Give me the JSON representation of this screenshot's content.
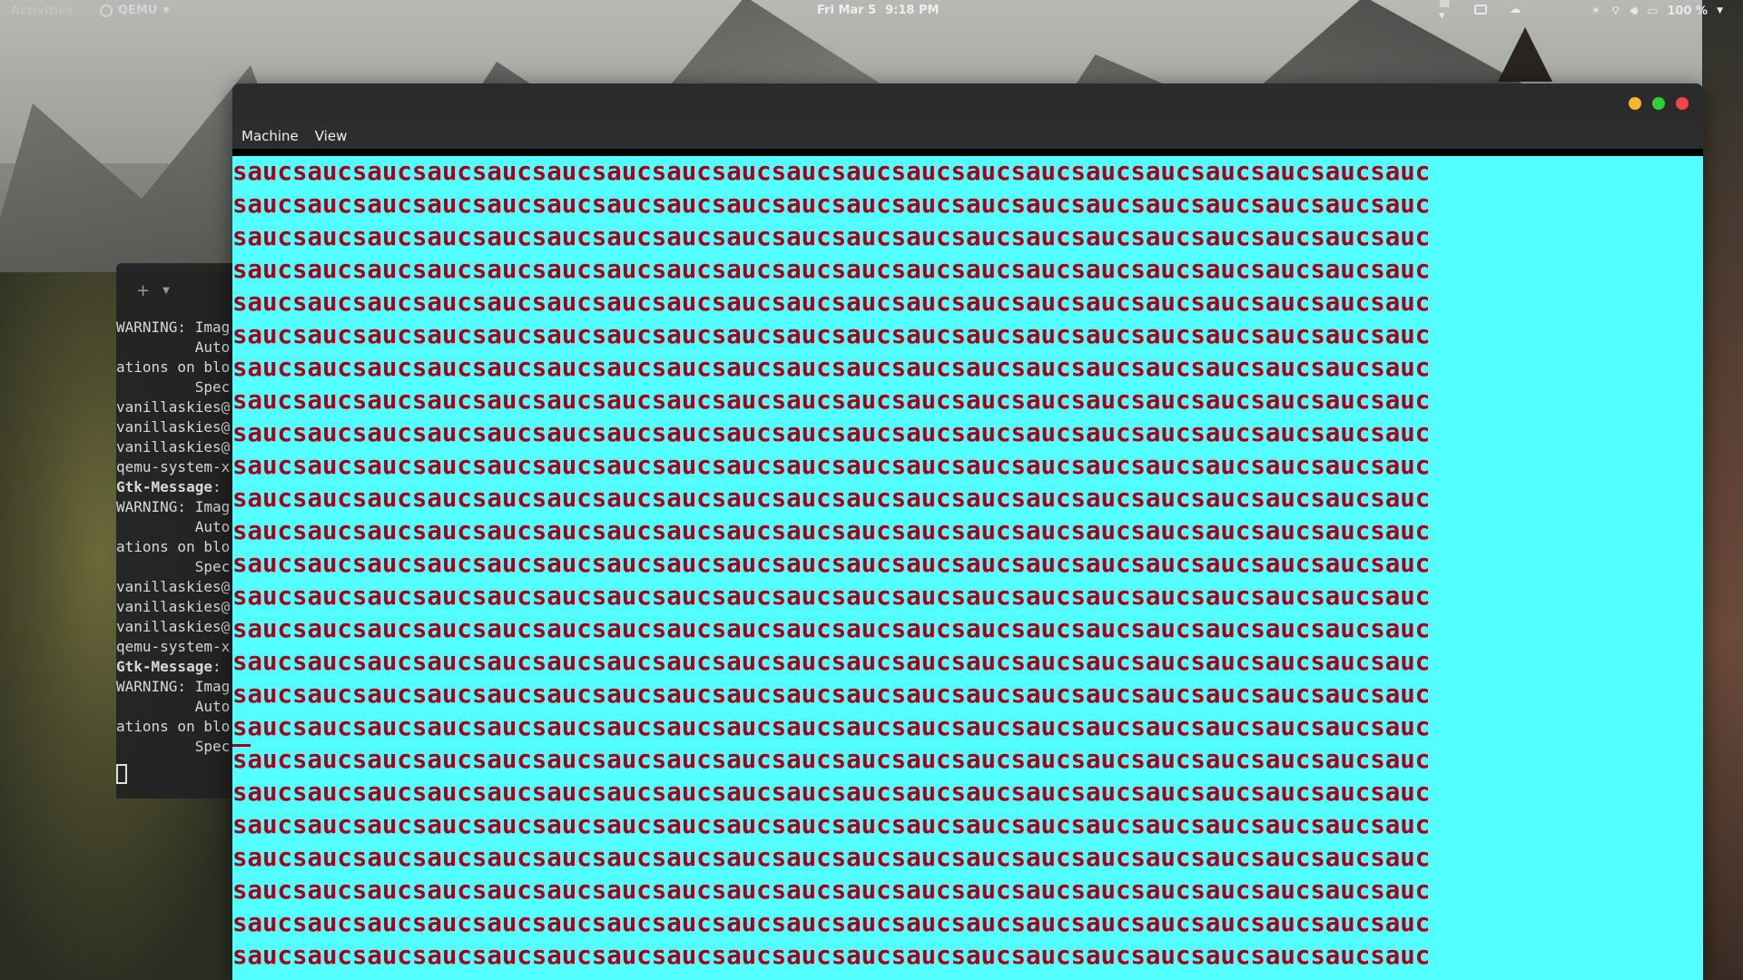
{
  "topbar": {
    "activities": "Activities",
    "app_name": "QEMU",
    "date": "Fri Mar 5",
    "time": "9:18 PM",
    "battery": "100 %"
  },
  "terminal": {
    "lines": [
      {
        "text": "WARNING: Imag",
        "bold_prefix": ""
      },
      {
        "text": "         Auto",
        "bold_prefix": ""
      },
      {
        "text": "ations on blo",
        "bold_prefix": ""
      },
      {
        "text": "         Spec",
        "bold_prefix": ""
      },
      {
        "text": "vanillaskies@",
        "bold_prefix": ""
      },
      {
        "text": "vanillaskies@",
        "bold_prefix": ""
      },
      {
        "text": "vanillaskies@",
        "bold_prefix": ""
      },
      {
        "text": "qemu-system-x",
        "bold_prefix": ""
      },
      {
        "text": ":",
        "bold_prefix": "Gtk-Message"
      },
      {
        "text": "WARNING: Imag",
        "bold_prefix": ""
      },
      {
        "text": "         Auto",
        "bold_prefix": ""
      },
      {
        "text": "ations on blo",
        "bold_prefix": ""
      },
      {
        "text": "         Spec",
        "bold_prefix": ""
      },
      {
        "text": "vanillaskies@",
        "bold_prefix": ""
      },
      {
        "text": "vanillaskies@",
        "bold_prefix": ""
      },
      {
        "text": "vanillaskies@",
        "bold_prefix": ""
      },
      {
        "text": "qemu-system-x",
        "bold_prefix": ""
      },
      {
        "text": ":",
        "bold_prefix": "Gtk-Message"
      },
      {
        "text": "WARNING: Imag",
        "bold_prefix": ""
      },
      {
        "text": "         Auto",
        "bold_prefix": ""
      },
      {
        "text": "ations on blo",
        "bold_prefix": ""
      },
      {
        "text": "         Spec",
        "bold_prefix": ""
      }
    ]
  },
  "qemu": {
    "menu": [
      "Machine",
      "View"
    ],
    "screen_rows": [
      "saucsaucsaucsaucsaucsaucsaucsaucsaucsaucsaucsaucsaucsaucsaucsaucsaucsaucsaucsauc",
      "saucsaucsaucsaucsaucsaucsaucsaucsaucsaucsaucsaucsaucsaucsaucsaucsaucsaucsaucsauc",
      "saucsaucsaucsaucsaucsaucsaucsaucsaucsaucsaucsaucsaucsaucsaucsaucsaucsaucsaucsauc",
      "saucsaucsaucsaucsaucsaucsaucsaucsaucsaucsaucsaucsaucsaucsaucsaucsaucsaucsaucsauc",
      "saucsaucsaucsaucsaucsaucsaucsaucsaucsaucsaucsaucsaucsaucsaucsaucsaucsaucsaucsauc",
      "saucsaucsaucsaucsaucsaucsaucsaucsaucsaucsaucsaucsaucsaucsaucsaucsaucsaucsaucsauc",
      "saucsaucsaucsaucsaucsaucsaucsaucsaucsaucsaucsaucsaucsaucsaucsaucsaucsaucsaucsauc",
      "saucsaucsaucsaucsaucsaucsaucsaucsaucsaucsaucsaucsaucsaucsaucsaucsaucsaucsaucsauc",
      "saucsaucsaucsaucsaucsaucsaucsaucsaucsaucsaucsaucsaucsaucsaucsaucsaucsaucsaucsauc",
      "saucsaucsaucsaucsaucsaucsaucsaucsaucsaucsaucsaucsaucsaucsaucsaucsaucsaucsaucsauc",
      "saucsaucsaucsaucsaucsaucsaucsaucsaucsaucsaucsaucsaucsaucsaucsaucsaucsaucsaucsauc",
      "saucsaucsaucsaucsaucsaucsaucsaucsaucsaucsaucsaucsaucsaucsaucsaucsaucsaucsaucsauc",
      "saucsaucsaucsaucsaucsaucsaucsaucsaucsaucsaucsaucsaucsaucsaucsaucsaucsaucsaucsauc",
      "saucsaucsaucsaucsaucsaucsaucsaucsaucsaucsaucsaucsaucsaucsaucsaucsaucsaucsaucsauc",
      "saucsaucsaucsaucsaucsaucsaucsaucsaucsaucsaucsaucsaucsaucsaucsaucsaucsaucsaucsauc",
      "saucsaucsaucsaucsaucsaucsaucsaucsaucsaucsaucsaucsaucsaucsaucsaucsaucsaucsaucsauc",
      "saucsaucsaucsaucsaucsaucsaucsaucsaucsaucsaucsaucsaucsaucsaucsaucsaucsaucsaucsauc",
      "saucsaucsaucsaucsaucsaucsaucsaucsaucsaucsaucsaucsaucsaucsaucsaucsaucsaucsaucsauc",
      "saucsaucsaucsaucsaucsaucsaucsaucsaucsaucsaucsaucsaucsaucsaucsaucsaucsaucsaucsauc",
      "saucsaucsaucsaucsaucsaucsaucsaucsaucsaucsaucsaucsaucsaucsaucsaucsaucsaucsaucsauc",
      "saucsaucsaucsaucsaucsaucsaucsaucsaucsaucsaucsaucsaucsaucsaucsaucsaucsaucsaucsauc",
      "saucsaucsaucsaucsaucsaucsaucsaucsaucsaucsaucsaucsaucsaucsaucsaucsaucsaucsaucsauc",
      "saucsaucsaucsaucsaucsaucsaucsaucsaucsaucsaucsaucsaucsaucsaucsaucsaucsaucsaucsauc",
      "saucsaucsaucsaucsaucsaucsaucsaucsaucsaucsaucsaucsaucsaucsaucsaucsaucsaucsaucsauc",
      "saucsaucsaucsaucsaucsaucsaucsaucsaucsaucsaucsaucsaucsaucsaucsaucsaucsaucsaucsauc"
    ]
  },
  "colors": {
    "vm_background": "#54ffff",
    "vm_text": "#a8001a",
    "close": "#f2444b",
    "maximize": "#2fcf3b",
    "minimize": "#f6b829"
  },
  "icons": {
    "app": "qemu-app-icon",
    "tray": [
      "screen-share-icon",
      "display-icon",
      "cloud-icon",
      "brightness-icon",
      "wifi-icon",
      "volume-icon",
      "battery-icon"
    ]
  }
}
